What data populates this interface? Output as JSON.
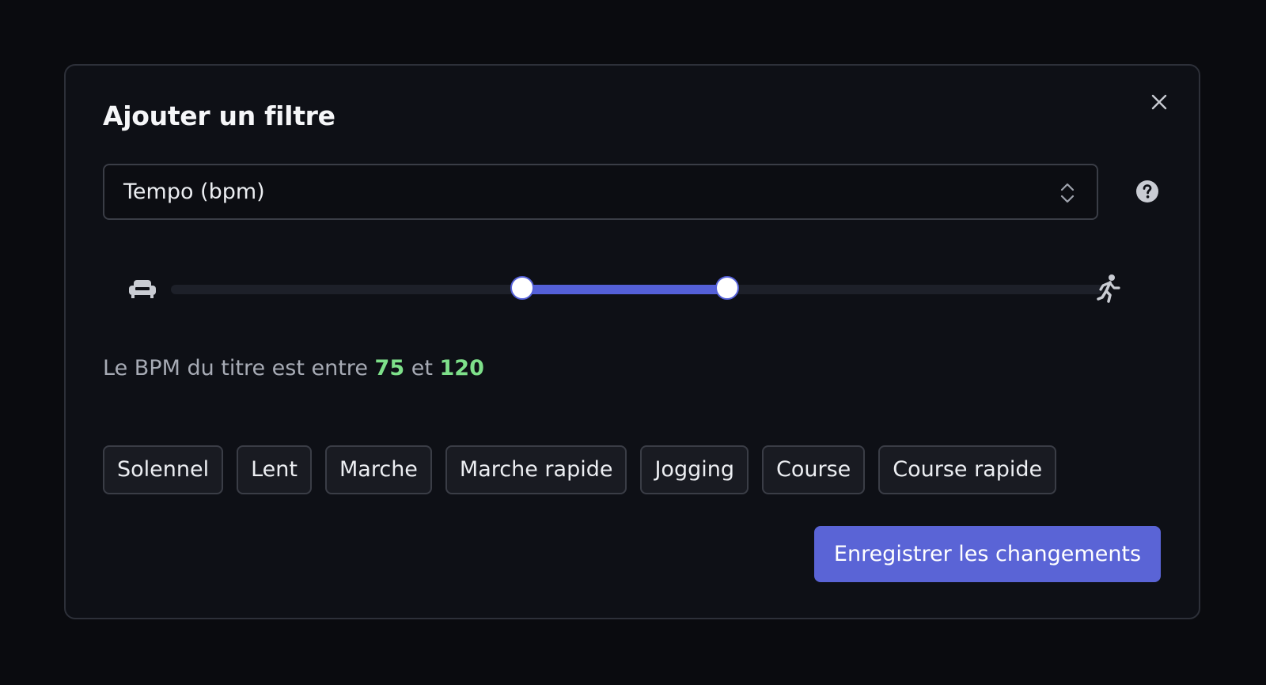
{
  "dialog": {
    "title": "Ajouter un filtre",
    "close_icon": "close-icon",
    "help_icon": "question-circle-icon"
  },
  "field_select": {
    "value": "Tempo (bpm)",
    "chevron_icon": "chevron-up-down-icon"
  },
  "tempo_slider": {
    "min_icon": "sofa-icon",
    "max_icon": "runner-icon",
    "lower_fraction": 0.377,
    "upper_fraction": 0.597,
    "accent_color": "#5460d8"
  },
  "bpm_summary": {
    "prefix": "Le BPM du titre est entre",
    "min": "75",
    "connector": "et",
    "max": "120",
    "value_color": "#7ee08a"
  },
  "presets": [
    "Solennel",
    "Lent",
    "Marche",
    "Marche rapide",
    "Jogging",
    "Course",
    "Course rapide"
  ],
  "actions": {
    "save_label": "Enregistrer les changements",
    "save_color": "#5a64d6"
  }
}
